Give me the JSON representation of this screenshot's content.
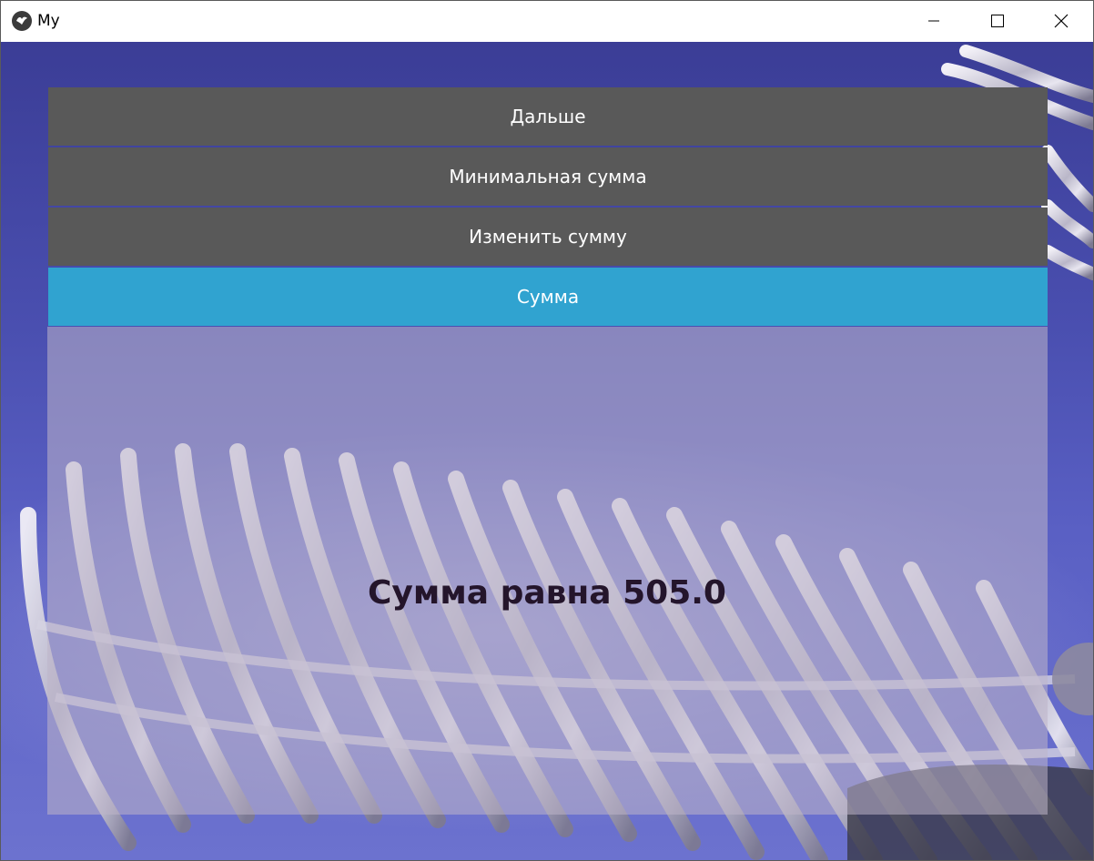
{
  "window": {
    "title": "My"
  },
  "buttons": {
    "next": "Дальше",
    "min_sum": "Минимальная сумма",
    "change_sum": "Изменить сумму",
    "sum": "Сумма"
  },
  "result": {
    "text": "Сумма равна 505.0"
  },
  "colors": {
    "button_bg": "#595959",
    "active_button_bg": "#30a3d0",
    "result_text": "#24152b"
  },
  "icons": [
    "kivy-app-icon",
    "minimize-icon",
    "maximize-icon",
    "close-icon"
  ]
}
